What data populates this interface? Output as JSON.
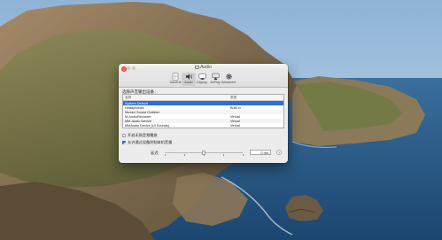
{
  "window": {
    "title": "Audio",
    "toolbar": [
      {
        "icon": "general-icon",
        "label": "General"
      },
      {
        "icon": "speaker-icon",
        "label": "Audio"
      },
      {
        "icon": "display-icon",
        "label": "Display"
      },
      {
        "icon": "airplay-icon",
        "label": "AirPlay"
      },
      {
        "icon": "advanced-gear-icon",
        "label": "Advanced"
      }
    ],
    "active_tab": "Audio"
  },
  "audio": {
    "section_label": "选择声音输出设备：",
    "columns": [
      "名称",
      "类型"
    ],
    "devices": [
      {
        "name": "System Default",
        "type": "",
        "selected": true
      },
      {
        "name": "Headphones",
        "type": "Built-in",
        "selected": false
      },
      {
        "name": "Movavi Sound Grabber",
        "type": "",
        "selected": false
      },
      {
        "name": "M-AudioRecorder",
        "type": "Virtual",
        "selected": false
      },
      {
        "name": "MM-Audio Device",
        "type": "Virtual",
        "selected": false
      },
      {
        "name": "MMAudio Device (UI Sounds)",
        "type": "Virtual",
        "selected": false
      }
    ],
    "option1_label": "开启无损音频播放",
    "option1_checked": false,
    "option2_label": "允许通过设备控制本机音量",
    "option2_checked": true,
    "delay_label": "延迟:",
    "delay_value": "0 ms",
    "help_label": "?"
  },
  "colors": {
    "selection": "#2d6fd8",
    "close_button": "#ff5f57",
    "sea": "#1f4e7a",
    "sky": "#b9d0e6"
  }
}
